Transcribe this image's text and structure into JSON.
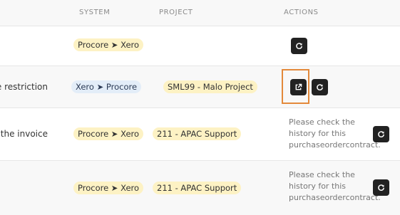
{
  "header": {
    "system": "SYSTEM",
    "project": "PROJECT",
    "actions": "ACTIONS"
  },
  "rows": [
    {
      "description": "",
      "system": "Procore ➤ Xero",
      "project": "",
      "note": ""
    },
    {
      "description": "ice restriction",
      "system": "Xero ➤ Procore",
      "project": "SML99 - Malo Project",
      "note": ""
    },
    {
      "description": " the invoice",
      "system": "Procore ➤ Xero",
      "project": "211 - APAC Support",
      "note": "Please check the history for this purchaseordercontract."
    },
    {
      "description": "",
      "system": "Procore ➤ Xero",
      "project": "211 - APAC Support",
      "note": "Please check the history for this purchaseordercontract."
    }
  ],
  "colors": {
    "badge_yellow": "#fdf2c4",
    "badge_blue": "#e3edf8",
    "button": "#222222",
    "highlight": "#e3893a"
  },
  "icons": {
    "retry": "refresh-icon",
    "open": "external-link-icon"
  }
}
